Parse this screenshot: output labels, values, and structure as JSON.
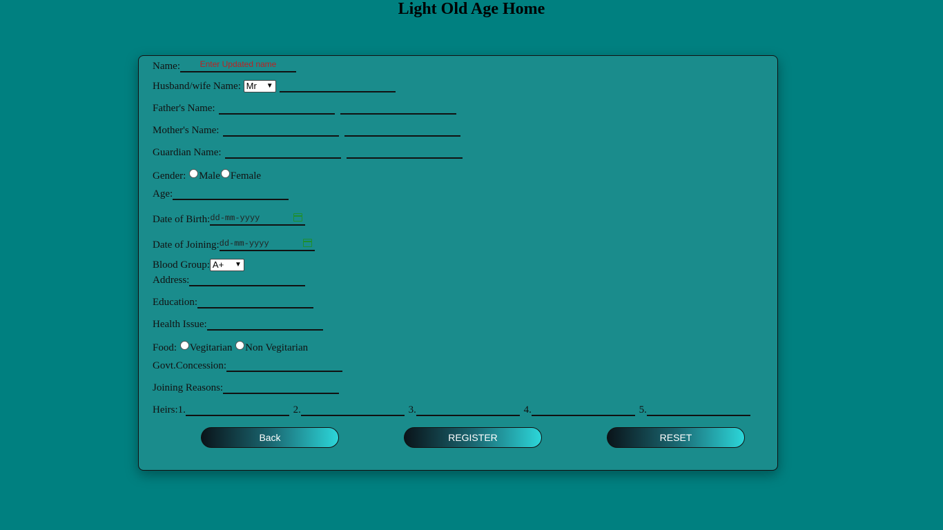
{
  "page": {
    "title": "Light Old Age Home"
  },
  "form": {
    "name": {
      "label": "Name:",
      "placeholder": "Enter Updated name"
    },
    "spouse": {
      "label": "Husband/wife Name:",
      "title_select": "Mr"
    },
    "father": {
      "label": "Father's Name:"
    },
    "mother": {
      "label": "Mother's Name:"
    },
    "guardian": {
      "label": "Guardian Name:"
    },
    "gender": {
      "label": "Gender:",
      "options": [
        "Male",
        "Female"
      ]
    },
    "age": {
      "label": "Age:"
    },
    "dob": {
      "label": "Date of Birth:",
      "placeholder": "dd-mm-yyyy"
    },
    "doj": {
      "label": "Date of Joining:",
      "placeholder": "dd-mm-yyyy"
    },
    "blood_group": {
      "label": "Blood Group:",
      "selected": "A+"
    },
    "address": {
      "label": "Address:"
    },
    "education": {
      "label": "Education:"
    },
    "health": {
      "label": "Health Issue:"
    },
    "food": {
      "label": "Food:",
      "options": [
        "Vegitarian",
        "Non Vegitarian"
      ]
    },
    "concession": {
      "label": "Govt.Concession:"
    },
    "reasons": {
      "label": "Joining Reasons:"
    },
    "heirs": {
      "label": "Heirs:",
      "numbers": [
        "1.",
        "2.",
        "3.",
        "4.",
        "5."
      ]
    }
  },
  "buttons": {
    "back": "Back",
    "register": "REGISTER",
    "reset": "RESET"
  }
}
